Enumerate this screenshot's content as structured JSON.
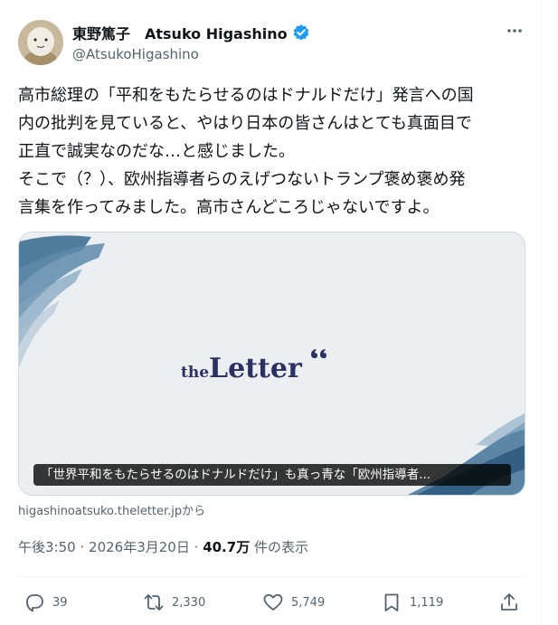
{
  "author": {
    "display_name": "東野篤子　Atsuko Higashino",
    "handle": "@AtsukoHigashino"
  },
  "tweet": {
    "lines": [
      "高市総理の「平和をもたらせるのはドナルドだけ」発言への国",
      "内の批判を見ていると、やはり日本の皆さんはとても真面目で",
      "正直で誠実なのだな…と感じました。",
      "そこで（？）、欧州指導者らのえげつないトランプ褒め褒め発",
      "言集を作ってみました。高市さんどころじゃないですよ。"
    ]
  },
  "card": {
    "logo_prefix": "the",
    "logo_main": "Letter",
    "caption": "「世界平和をもたらせるのはドナルドだけ」も真っ青な「欧州指導者...",
    "source": "higashinoatsuko.theletter.jpから"
  },
  "meta": {
    "time": "午後3:50",
    "date": "2026年3月20日",
    "sep": "·",
    "views": "40.7万",
    "views_label": "件の表示"
  },
  "actions": {
    "replies": "39",
    "reposts": "2,330",
    "likes": "5,749",
    "bookmarks": "1,119"
  },
  "colors": {
    "verified": "#1d9bf0",
    "logo": "#2c3163",
    "text_secondary": "#536471"
  },
  "icons": [
    "more-icon",
    "verified-badge-icon",
    "reply-icon",
    "repost-icon",
    "like-icon",
    "bookmark-icon",
    "share-icon"
  ]
}
